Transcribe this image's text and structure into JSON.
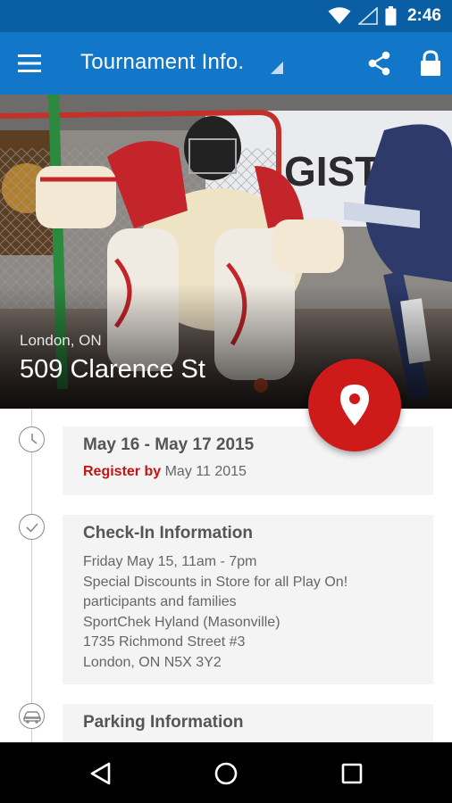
{
  "status_bar": {
    "time": "2:46",
    "icons": [
      "wifi-icon",
      "signal-icon",
      "battery-icon"
    ]
  },
  "app_bar": {
    "title": "Tournament Info.",
    "icons": [
      "menu-icon",
      "dropdown-caret-icon",
      "share-icon",
      "lock-icon"
    ]
  },
  "hero": {
    "city": "London, ON",
    "address": "509 Clarence St"
  },
  "fab": {
    "icon": "map-pin-icon",
    "color": "#cf1a1a"
  },
  "events": [
    {
      "icon": "clock-icon",
      "title": "May 16 - May 17 2015",
      "register_label": "Register by",
      "register_date": "May 11 2015"
    },
    {
      "icon": "check-circle-icon",
      "title": "Check-In Information",
      "lines": [
        "Friday May 15, 11am - 7pm",
        "Special Discounts in Store for all Play On!",
        "participants and families",
        "SportChek Hyland (Masonville)",
        "1735 Richmond Street #3",
        "London, ON N5X 3Y2"
      ]
    },
    {
      "icon": "car-icon",
      "title": "Parking Information"
    }
  ],
  "nav_bar": {
    "icons": [
      "back-icon",
      "home-icon",
      "recents-icon"
    ]
  },
  "colors": {
    "status_bar": "#0a5fa4",
    "app_bar": "#1377c9",
    "accent_red": "#c41414",
    "card_bg": "#f4f4f5"
  }
}
